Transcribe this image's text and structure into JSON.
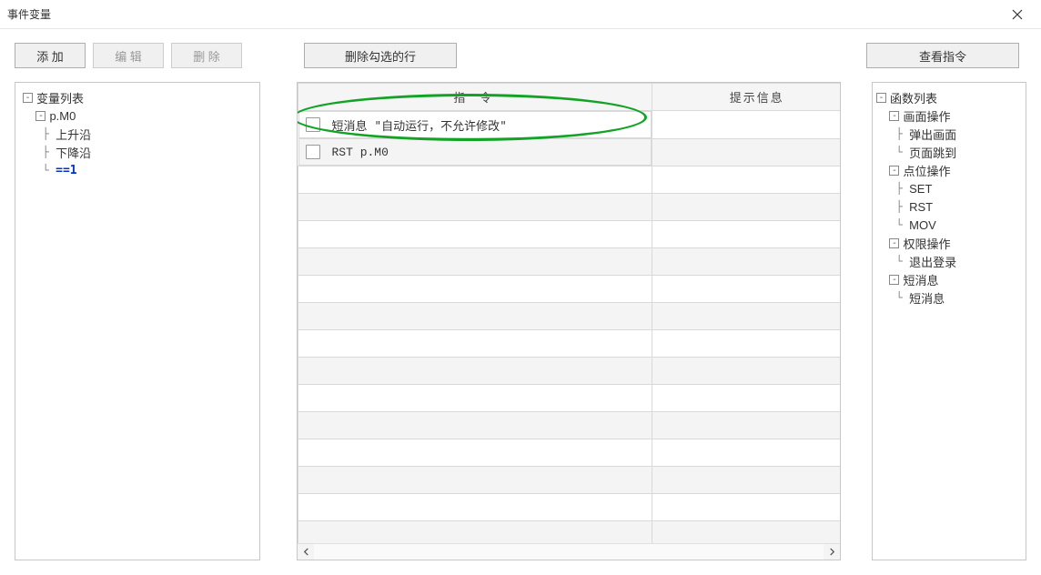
{
  "window": {
    "title": "事件变量"
  },
  "toolbar": {
    "add": "添 加",
    "edit": "编 辑",
    "delete": "删 除",
    "delete_checked": "删除勾选的行",
    "view_cmd": "查看指令"
  },
  "var_tree": {
    "root": "变量列表",
    "items": [
      {
        "label": "p.M0",
        "children": [
          {
            "label": "上升沿"
          },
          {
            "label": "下降沿"
          },
          {
            "label": "==1",
            "selected": true
          }
        ]
      }
    ]
  },
  "table": {
    "columns": {
      "command": "指 令",
      "tip": "提示信息"
    },
    "rows": [
      {
        "cmd_text": "短消息 \"自动运行，不允许修改\"",
        "tip": "",
        "mono": false
      },
      {
        "cmd_text": "RST p.M0",
        "tip": "",
        "mono": true
      }
    ],
    "blank_rows": 14
  },
  "func_tree": {
    "root": "函数列表",
    "groups": [
      {
        "label": "画面操作",
        "children": [
          "弹出画面",
          "页面跳到"
        ]
      },
      {
        "label": "点位操作",
        "children": [
          "SET",
          "RST",
          "MOV"
        ]
      },
      {
        "label": "权限操作",
        "children": [
          "退出登录"
        ]
      },
      {
        "label": "短消息",
        "children": [
          "短消息"
        ]
      }
    ]
  },
  "annotation": {
    "highlight_row": 0
  }
}
